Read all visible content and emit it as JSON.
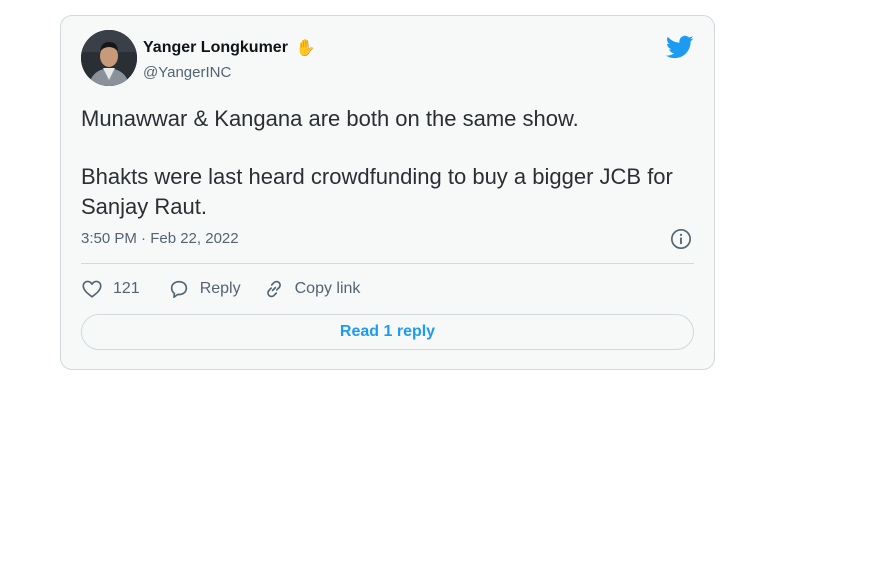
{
  "tweet": {
    "author_name": "Yanger Longkumer",
    "author_emoji": "✋",
    "author_handle": "@YangerINC",
    "text_line_1": "Munawwar & Kangana are both on the same show.",
    "text_line_2": "Bhakts were last heard crowdfunding to buy a bigger JCB for Sanjay Raut.",
    "timestamp": "3:50 PM · Feb 22, 2022"
  },
  "actions": {
    "like_count": "121",
    "reply_label": "Reply",
    "copy_link_label": "Copy link"
  },
  "read_reply_label": "Read 1 reply",
  "icons": {
    "brand": "twitter-bird-icon",
    "like": "heart-icon",
    "reply": "speech-bubble-icon",
    "copy": "link-icon",
    "info": "info-icon"
  },
  "colors": {
    "twitter_blue": "#1d9bf0",
    "secondary_text": "#536471",
    "border": "#cfd9de"
  }
}
